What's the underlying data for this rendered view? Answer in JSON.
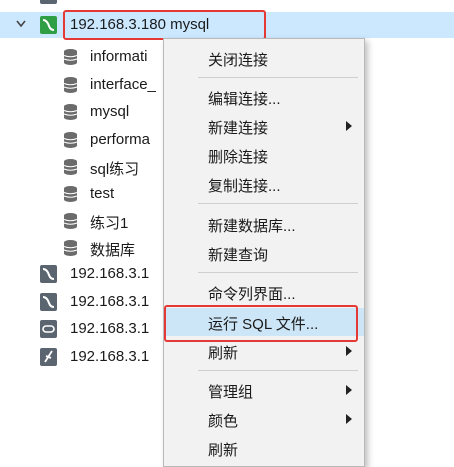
{
  "tree": {
    "connection": {
      "label": "192.168.3.180 mysql"
    },
    "databases": [
      "informati",
      "interface_",
      "mysql",
      "performa",
      "sql练习",
      "test",
      "练习1",
      "数据库"
    ],
    "other_connections": [
      "192.168.3.1",
      "192.168.3.1",
      "192.168.3.1",
      "192.168.3.1"
    ]
  },
  "context_menu": {
    "items": [
      "关闭连接",
      "编辑连接...",
      "新建连接",
      "删除连接",
      "复制连接...",
      "新建数据库...",
      "新建查询",
      "命令列界面...",
      "运行 SQL 文件...",
      "刷新",
      "管理组",
      "颜色",
      "刷新"
    ]
  },
  "colors": {
    "selected_row": "#cce8ff",
    "highlight": "#cde6f7",
    "annotation": "#e53935",
    "connection_icon": "#2f9e44"
  }
}
